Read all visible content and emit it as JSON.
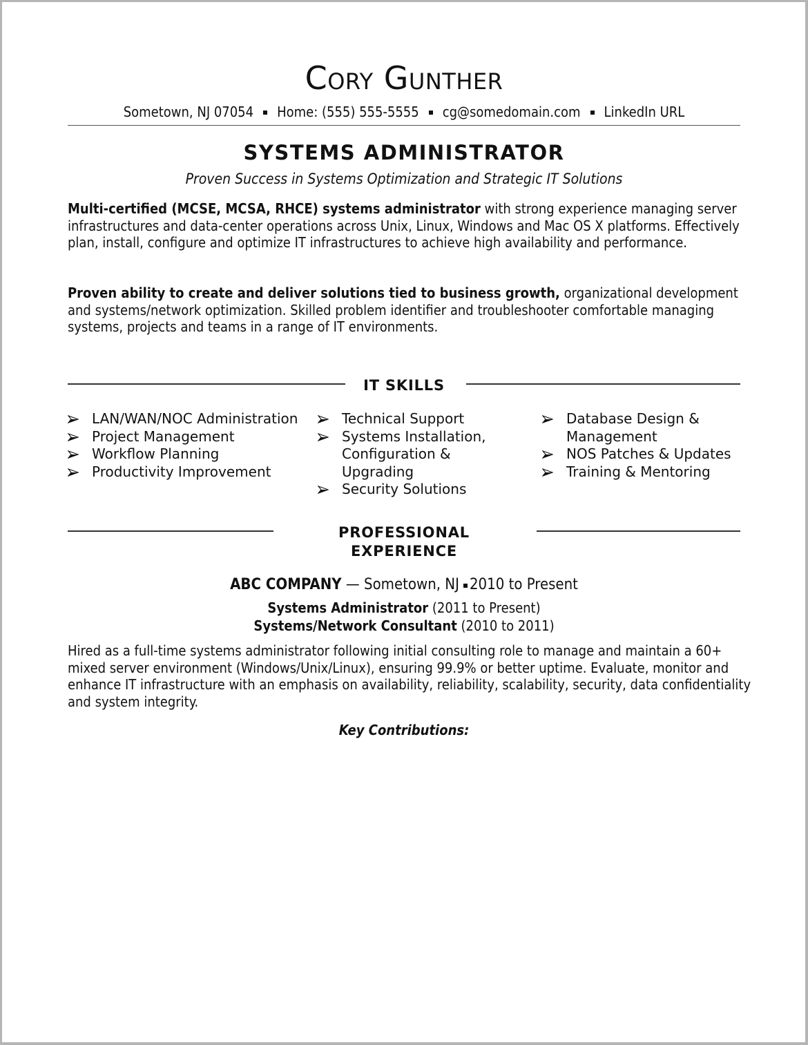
{
  "header": {
    "name": "Cory Gunther",
    "contact": {
      "location": "Sometown, NJ 07054",
      "phone": "Home: (555) 555-5555",
      "email": "cg@somedomain.com",
      "linkedin": "LinkedIn URL"
    },
    "separator_icon": "small-square"
  },
  "title": "SYSTEMS ADMINISTRATOR",
  "tagline": "Proven Success in Systems Optimization and Strategic IT Solutions",
  "summary": [
    {
      "bold": "Multi-certified (MCSE, MCSA, RHCE) systems administrator",
      "text": " with strong experience managing server infrastructures and data-center operations across Unix, Linux, Windows and Mac OS X platforms. Effectively plan, install, configure and optimize IT infrastructures to achieve high availability and performance."
    },
    {
      "bold": "Proven ability to create and deliver solutions tied to business growth,",
      "text": " organizational development and systems/network optimization. Skilled problem identifier and troubleshooter comfortable managing systems, projects and teams in a range of IT environments."
    }
  ],
  "skills": {
    "heading": "IT SKILLS",
    "bullet_icon": "arrowhead-right",
    "columns": [
      [
        "LAN/WAN/NOC Administration",
        "Project Management",
        "Workflow Planning",
        "Productivity Improvement"
      ],
      [
        "Technical Support",
        "Systems Installation, Configuration & Upgrading",
        "Security Solutions"
      ],
      [
        "Database Design & Management",
        "NOS Patches & Updates",
        "Training & Mentoring"
      ]
    ]
  },
  "experience": {
    "heading_line1": "PROFESSIONAL",
    "heading_line2": "EXPERIENCE",
    "company": "ABC COMPANY",
    "location": " — Sometown, NJ",
    "dates": "2010 to Present",
    "roles": [
      {
        "title": "Systems Administrator",
        "dates": " (2011 to Present)"
      },
      {
        "title": "Systems/Network Consultant",
        "dates": " (2010 to 2011)"
      }
    ],
    "description": "Hired as a full-time systems administrator following initial consulting role to manage and maintain a 60+ mixed server environment (Windows/Unix/Linux), ensuring 99.9% or better uptime. Evaluate, monitor and enhance IT infrastructure with an emphasis on availability, reliability, scalability, security, data confidentiality and system integrity.",
    "key_contributions_label": "Key Contributions:"
  }
}
